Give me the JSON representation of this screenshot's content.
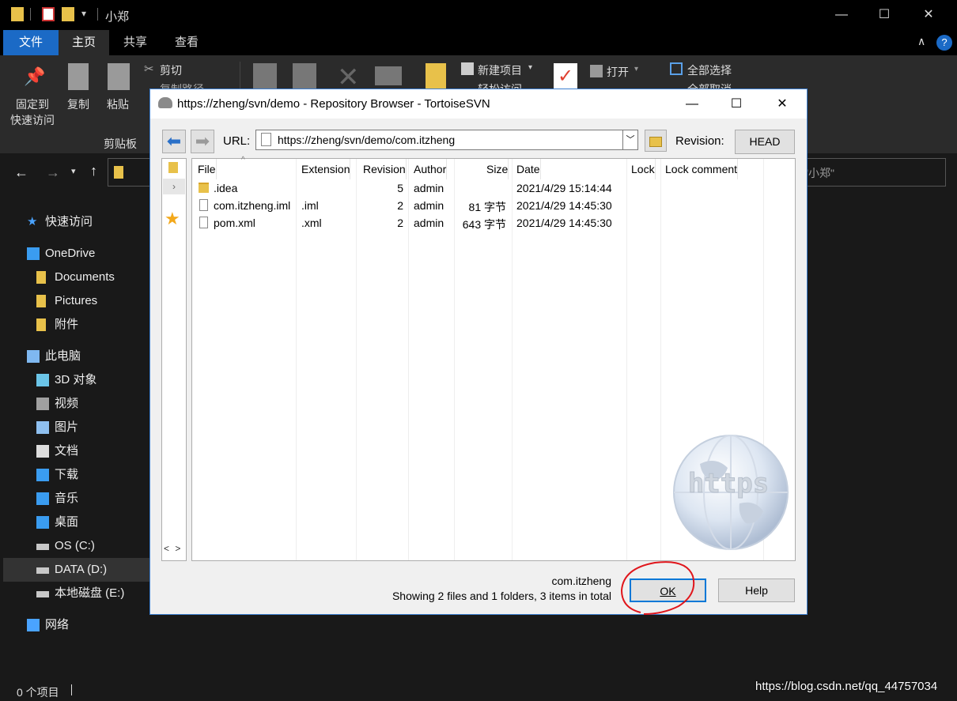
{
  "explorer": {
    "title": "小郑",
    "tabs": [
      "文件",
      "主页",
      "共享",
      "查看"
    ],
    "ribbon": {
      "pin": [
        "固定到",
        "快速访问"
      ],
      "copy": "复制",
      "paste": "粘贴",
      "cut": "剪切",
      "copy_path": "复制路径",
      "clipboard_group": "剪贴板",
      "new_item": "新建项目",
      "easy_access": "轻松访问",
      "open": "打开",
      "select_all": "全部选择",
      "select_none": "全部取消"
    },
    "search_placeholder": "\"小郑\"",
    "sidebar": [
      {
        "label": "快速访问",
        "icon": "star-icon"
      },
      {
        "label": "OneDrive",
        "icon": "cloud-icon"
      },
      {
        "label": "Documents",
        "icon": "folder-icon"
      },
      {
        "label": "Pictures",
        "icon": "folder-icon"
      },
      {
        "label": "附件",
        "icon": "folder-icon"
      },
      {
        "label": "此电脑",
        "icon": "computer-icon"
      },
      {
        "label": "3D 对象",
        "icon": "cube-icon"
      },
      {
        "label": "视频",
        "icon": "video-icon"
      },
      {
        "label": "图片",
        "icon": "image-icon"
      },
      {
        "label": "文档",
        "icon": "document-icon"
      },
      {
        "label": "下载",
        "icon": "download-icon"
      },
      {
        "label": "音乐",
        "icon": "music-icon"
      },
      {
        "label": "桌面",
        "icon": "desktop-icon"
      },
      {
        "label": "OS (C:)",
        "icon": "drive-icon"
      },
      {
        "label": "DATA (D:)",
        "icon": "drive-icon"
      },
      {
        "label": "本地磁盘 (E:)",
        "icon": "drive-icon"
      },
      {
        "label": "网络",
        "icon": "network-icon"
      }
    ],
    "status": "0 个项目",
    "watermark": "https://blog.csdn.net/qq_44757034"
  },
  "dialog": {
    "title": "https://zheng/svn/demo - Repository Browser - TortoiseSVN",
    "url_label": "URL:",
    "url_value": "https://zheng/svn/demo/com.itzheng",
    "revision_label": "Revision:",
    "revision_value": "HEAD",
    "columns": [
      "File",
      "Extension",
      "Revision",
      "Author",
      "Size",
      "Date",
      "Lock",
      "Lock comment"
    ],
    "rows": [
      {
        "file": ".idea",
        "ext": "",
        "rev": "5",
        "author": "admin",
        "size": "",
        "date": "2021/4/29 15:14:44",
        "kind": "folder"
      },
      {
        "file": "com.itzheng.iml",
        "ext": ".iml",
        "rev": "2",
        "author": "admin",
        "size": "81 字节",
        "date": "2021/4/29 14:45:30",
        "kind": "file"
      },
      {
        "file": "pom.xml",
        "ext": ".xml",
        "rev": "2",
        "author": "admin",
        "size": "643 字节",
        "date": "2021/4/29 14:45:30",
        "kind": "file"
      }
    ],
    "watermark_text": "https",
    "status_path": "com.itzheng",
    "status_summary": "Showing 2 files and 1 folders, 3 items in total",
    "ok": "OK",
    "help": "Help",
    "tree_scroll": "< >"
  }
}
